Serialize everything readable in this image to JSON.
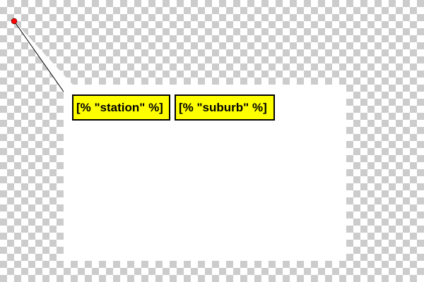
{
  "colors": {
    "token_background": "#ffff00",
    "token_border": "#000000",
    "callout_background": "#ffffff",
    "anchor": "#ff0000",
    "checker_light": "#ffffff",
    "checker_dark": "#cccccc"
  },
  "tokens": [
    {
      "label": "[% \"station\" %]"
    },
    {
      "label": "[% \"suburb\" %]"
    }
  ]
}
